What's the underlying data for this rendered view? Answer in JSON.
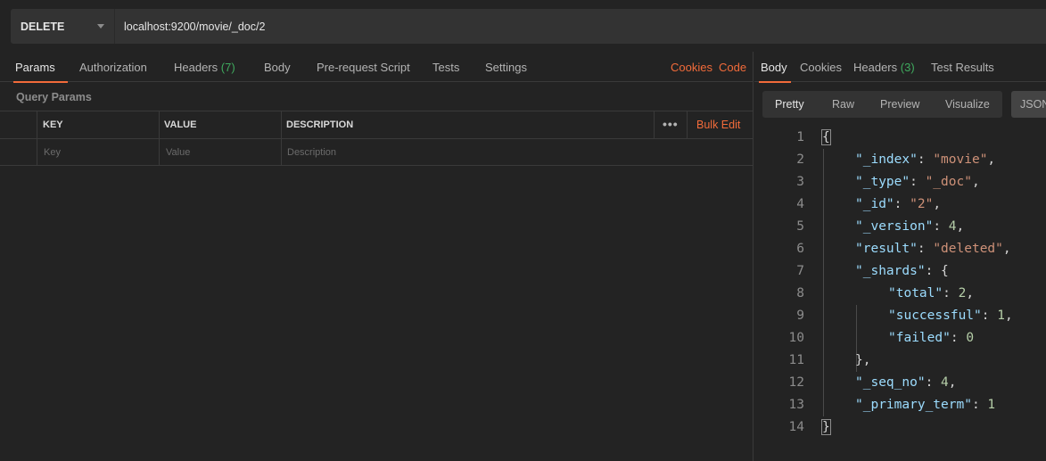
{
  "request": {
    "method": "DELETE",
    "url": "localhost:9200/movie/_doc/2"
  },
  "left_tabs": {
    "params": "Params",
    "authorization": "Authorization",
    "headers": "Headers",
    "headers_count": "(7)",
    "body": "Body",
    "prerequest": "Pre-request Script",
    "tests": "Tests",
    "settings": "Settings",
    "cookies": "Cookies",
    "code": "Code"
  },
  "query_params": {
    "label": "Query Params",
    "columns": [
      "KEY",
      "VALUE",
      "DESCRIPTION"
    ],
    "more": "•••",
    "bulk_edit": "Bulk Edit",
    "placeholders": [
      "Key",
      "Value",
      "Description"
    ]
  },
  "response_tabs": {
    "body": "Body",
    "cookies": "Cookies",
    "headers": "Headers",
    "headers_count": "(3)",
    "test_results": "Test Results"
  },
  "view_modes": {
    "pretty": "Pretty",
    "raw": "Raw",
    "preview": "Preview",
    "visualize": "Visualize",
    "format": "JSON"
  },
  "response_lines": [
    {
      "n": "1",
      "indent": 0,
      "parts": [
        [
          "p",
          "{"
        ]
      ]
    },
    {
      "n": "2",
      "indent": 1,
      "parts": [
        [
          "k",
          "\"_index\""
        ],
        [
          "p",
          ": "
        ],
        [
          "s",
          "\"movie\""
        ],
        [
          "p",
          ","
        ]
      ]
    },
    {
      "n": "3",
      "indent": 1,
      "parts": [
        [
          "k",
          "\"_type\""
        ],
        [
          "p",
          ": "
        ],
        [
          "s",
          "\"_doc\""
        ],
        [
          "p",
          ","
        ]
      ]
    },
    {
      "n": "4",
      "indent": 1,
      "parts": [
        [
          "k",
          "\"_id\""
        ],
        [
          "p",
          ": "
        ],
        [
          "s",
          "\"2\""
        ],
        [
          "p",
          ","
        ]
      ]
    },
    {
      "n": "5",
      "indent": 1,
      "parts": [
        [
          "k",
          "\"_version\""
        ],
        [
          "p",
          ": "
        ],
        [
          "n",
          "4"
        ],
        [
          "p",
          ","
        ]
      ]
    },
    {
      "n": "6",
      "indent": 1,
      "parts": [
        [
          "k",
          "\"result\""
        ],
        [
          "p",
          ": "
        ],
        [
          "s",
          "\"deleted\""
        ],
        [
          "p",
          ","
        ]
      ]
    },
    {
      "n": "7",
      "indent": 1,
      "parts": [
        [
          "k",
          "\"_shards\""
        ],
        [
          "p",
          ": {"
        ]
      ]
    },
    {
      "n": "8",
      "indent": 2,
      "parts": [
        [
          "k",
          "\"total\""
        ],
        [
          "p",
          ": "
        ],
        [
          "n",
          "2"
        ],
        [
          "p",
          ","
        ]
      ]
    },
    {
      "n": "9",
      "indent": 2,
      "parts": [
        [
          "k",
          "\"successful\""
        ],
        [
          "p",
          ": "
        ],
        [
          "n",
          "1"
        ],
        [
          "p",
          ","
        ]
      ]
    },
    {
      "n": "10",
      "indent": 2,
      "parts": [
        [
          "k",
          "\"failed\""
        ],
        [
          "p",
          ": "
        ],
        [
          "n",
          "0"
        ]
      ]
    },
    {
      "n": "11",
      "indent": 1,
      "parts": [
        [
          "p",
          "},"
        ]
      ]
    },
    {
      "n": "12",
      "indent": 1,
      "parts": [
        [
          "k",
          "\"_seq_no\""
        ],
        [
          "p",
          ": "
        ],
        [
          "n",
          "4"
        ],
        [
          "p",
          ","
        ]
      ]
    },
    {
      "n": "13",
      "indent": 1,
      "parts": [
        [
          "k",
          "\"_primary_term\""
        ],
        [
          "p",
          ": "
        ],
        [
          "n",
          "1"
        ]
      ]
    },
    {
      "n": "14",
      "indent": 0,
      "parts": [
        [
          "p",
          "}"
        ]
      ]
    }
  ]
}
